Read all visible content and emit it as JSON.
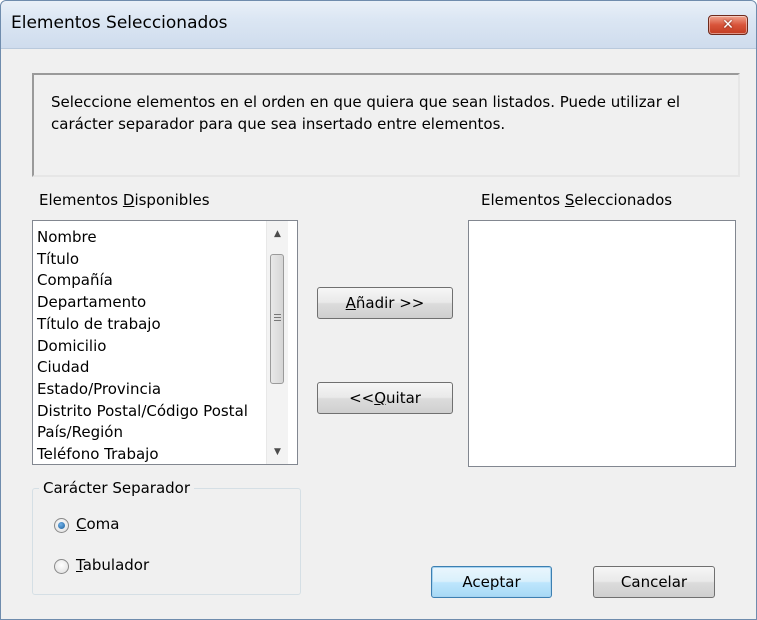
{
  "window": {
    "title": "Elementos Seleccionados",
    "close_symbol": "✕"
  },
  "info": {
    "text": "Seleccione elementos en el orden en que quiera que sean listados. Puede utilizar el carácter separador para que sea insertado entre elementos."
  },
  "available": {
    "label_pre": "Elementos ",
    "label_key": "D",
    "label_post": "isponibles",
    "items": [
      "Nombre",
      "Título",
      "Compañía",
      "Departamento",
      "Título de trabajo",
      "Domicilio",
      "Ciudad",
      "Estado/Provincia",
      "Distrito Postal/Código Postal",
      "País/Región",
      "Teléfono Trabajo"
    ],
    "scroll_up_icon": "▲",
    "scroll_down_icon": "▼"
  },
  "selected": {
    "label_pre": "Elementos ",
    "label_key": "S",
    "label_post": "eleccionados",
    "items": []
  },
  "buttons": {
    "add_key": "A",
    "add_rest": "ñadir >>",
    "remove_pre": "<< ",
    "remove_key": "Q",
    "remove_rest": "uitar",
    "ok": "Aceptar",
    "cancel": "Cancelar"
  },
  "separator": {
    "legend": "Carácter Separador",
    "options": [
      {
        "key": "C",
        "rest": "oma",
        "checked": true
      },
      {
        "key": "T",
        "rest": "abulador",
        "checked": false
      }
    ]
  }
}
